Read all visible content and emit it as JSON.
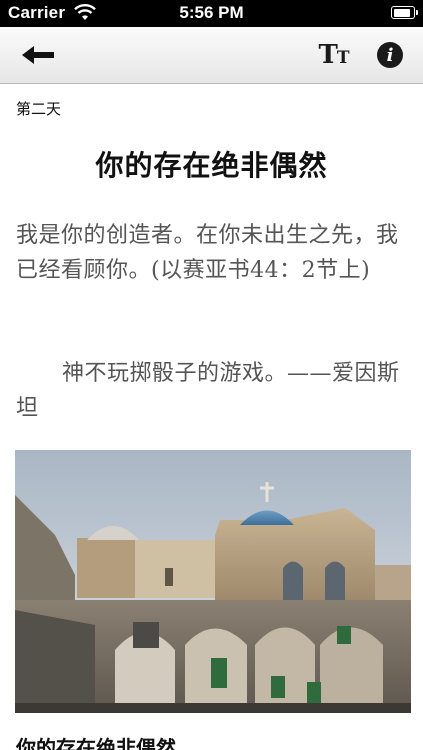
{
  "status_bar": {
    "carrier": "Carrier",
    "time": "5:56 PM",
    "battery_level": 0.9
  },
  "nav_bar": {
    "back_icon": "back-arrow-icon",
    "font_size_icon": "text-size-icon",
    "font_size_big": "T",
    "font_size_small": "T",
    "info_icon": "info-icon",
    "info_glyph": "i"
  },
  "article": {
    "day_label": "第二天",
    "title": "你的存在绝非偶然",
    "verse": "我是你的创造者。在你未出生之先，我已经看顾你。(以赛亚书44：2节上)",
    "quote": "神不玩掷骰子的游戏。——爱因斯坦",
    "image_icon": "photo-church-of-holy-sepulchre",
    "subtitle": "你的存在绝非偶然"
  }
}
